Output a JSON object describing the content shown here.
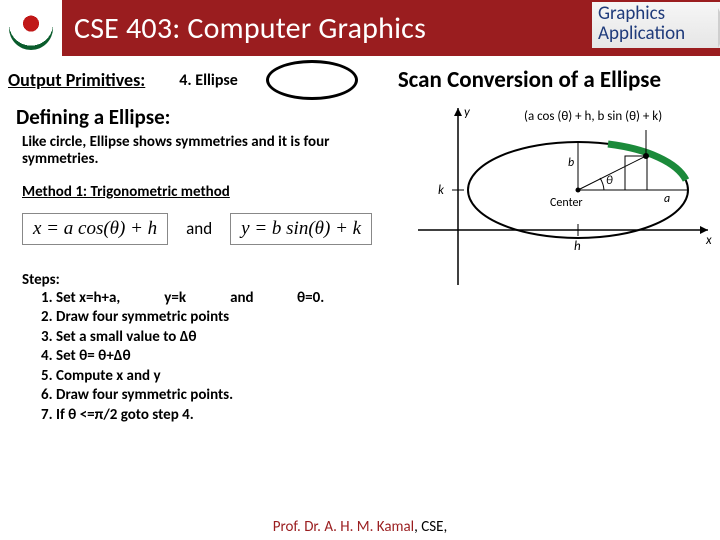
{
  "header": {
    "course_title": "CSE 403: Computer Graphics",
    "corner_line1": "Graphics",
    "corner_line2": "Application"
  },
  "subhead": {
    "label": "Output Primitives:",
    "topic": "4. Ellipse",
    "scan_title": "Scan Conversion of a Ellipse"
  },
  "section_title": "Defining a Ellipse:",
  "intro_text": "Like circle, Ellipse shows symmetries and it is four symmetries.",
  "method_label": "Method 1: Trigonometric method",
  "formula": {
    "eq1": "x = a cos(θ) + h",
    "and": "and",
    "eq2": "y = b sin(θ) + k"
  },
  "steps_label": "Steps:",
  "steps": [
    {
      "a": "Set x=h+a,",
      "b": "y=k",
      "c": "and",
      "d": "θ=0."
    },
    "Draw four symmetric points",
    "Set a small value to Δθ",
    "Set θ= θ+Δθ",
    "Compute x and y",
    "Draw four symmetric points.",
    "If θ <=π/2 goto step 4."
  ],
  "diagram": {
    "top_label": "(a cos (θ) + h, b sin (θ) + k)",
    "center_label": "Center",
    "a_label": "a",
    "b_label": "b",
    "theta_label": "θ",
    "k_label": "k",
    "h_label": "h",
    "x_axis": "x",
    "y_axis": "y"
  },
  "footer": {
    "name": "Prof. Dr. A. H. M. Kamal",
    "rest": ", CSE,"
  }
}
